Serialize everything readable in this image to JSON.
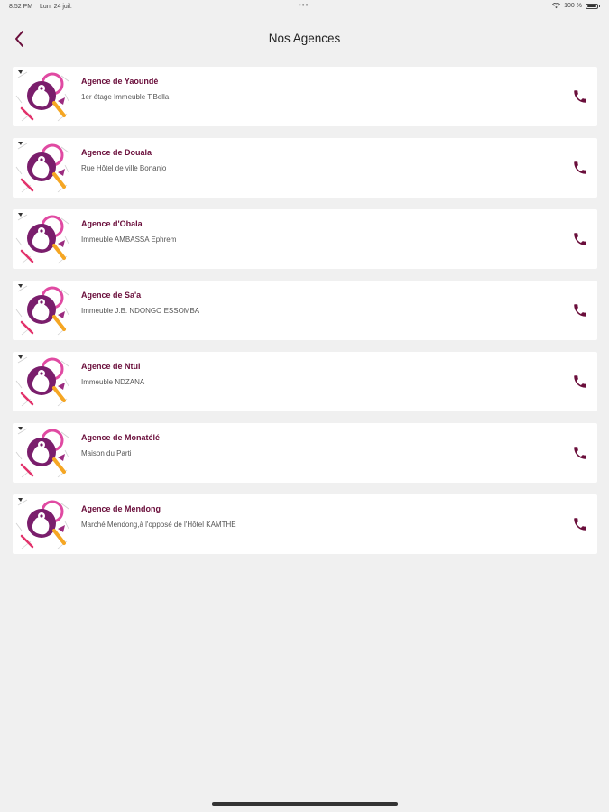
{
  "status_bar": {
    "time": "8:52 PM",
    "date": "Lun. 24 juil.",
    "battery": "100 %",
    "wifi_icon": "wifi-icon",
    "battery_icon": "battery-icon"
  },
  "nav": {
    "title": "Nos Agences",
    "back_icon": "chevron-left-icon"
  },
  "colors": {
    "accent": "#6a0e3b",
    "background": "#f0f0f0",
    "card": "#ffffff"
  },
  "agencies": [
    {
      "name": "Agence de Yaoundé",
      "address": "1er étage Immeuble T.Bella",
      "phone_icon": "phone-icon"
    },
    {
      "name": "Agence de Douala",
      "address": "Rue Hôtel de ville Bonanjo",
      "phone_icon": "phone-icon"
    },
    {
      "name": "Agence d'Obala",
      "address": "Immeuble AMBASSA Ephrem",
      "phone_icon": "phone-icon"
    },
    {
      "name": "Agence de Sa'a",
      "address": "Immeuble J.B. NDONGO ESSOMBA",
      "phone_icon": "phone-icon"
    },
    {
      "name": "Agence de Ntui",
      "address": "Immeuble NDZANA",
      "phone_icon": "phone-icon"
    },
    {
      "name": "Agence de Monatélé",
      "address": "Maison du Parti",
      "phone_icon": "phone-icon"
    },
    {
      "name": "Agence de Mendong",
      "address": "Marché Mendong,à l'opposé de l'Hôtel KAMTHE",
      "phone_icon": "phone-icon"
    }
  ]
}
